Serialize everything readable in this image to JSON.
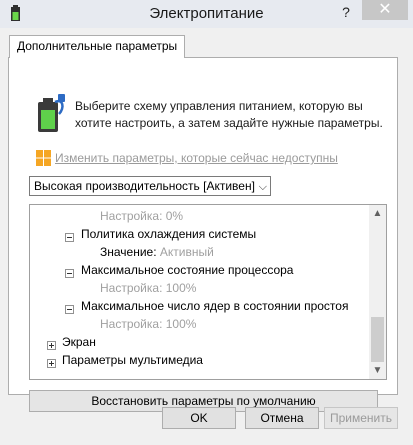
{
  "window": {
    "title": "Электропитание",
    "help_label": "?",
    "close_label": "✕"
  },
  "tab": {
    "label": "Дополнительные параметры"
  },
  "description": "Выберите схему управления питанием, которую вы хотите настроить, а затем задайте нужные параметры.",
  "change_link": "Изменить параметры, которые сейчас недоступны",
  "plan_select": {
    "value": "Высокая производительность [Активен]"
  },
  "tree": {
    "row0": "Настройка: 0%",
    "cooling": {
      "label": "Политика охлаждения системы",
      "value_label": "Значение:",
      "value": "Активный"
    },
    "max_cpu": {
      "label": "Максимальное состояние процессора",
      "value": "Настройка: 100%"
    },
    "max_cores": {
      "label": "Максимальное число ядер в состоянии простоя",
      "value": "Настройка: 100%"
    },
    "display": {
      "label": "Экран"
    },
    "multimedia": {
      "label": "Параметры мультимедиа"
    }
  },
  "restore_button": "Восстановить параметры по умолчанию",
  "buttons": {
    "ok": "OK",
    "cancel": "Отмена",
    "apply": "Применить"
  },
  "icons": [
    "app-power-icon",
    "battery-plug-icon",
    "shield-icon",
    "chevron-down-icon",
    "expand-icon",
    "collapse-icon",
    "scroll-up-icon",
    "scroll-down-icon"
  ]
}
